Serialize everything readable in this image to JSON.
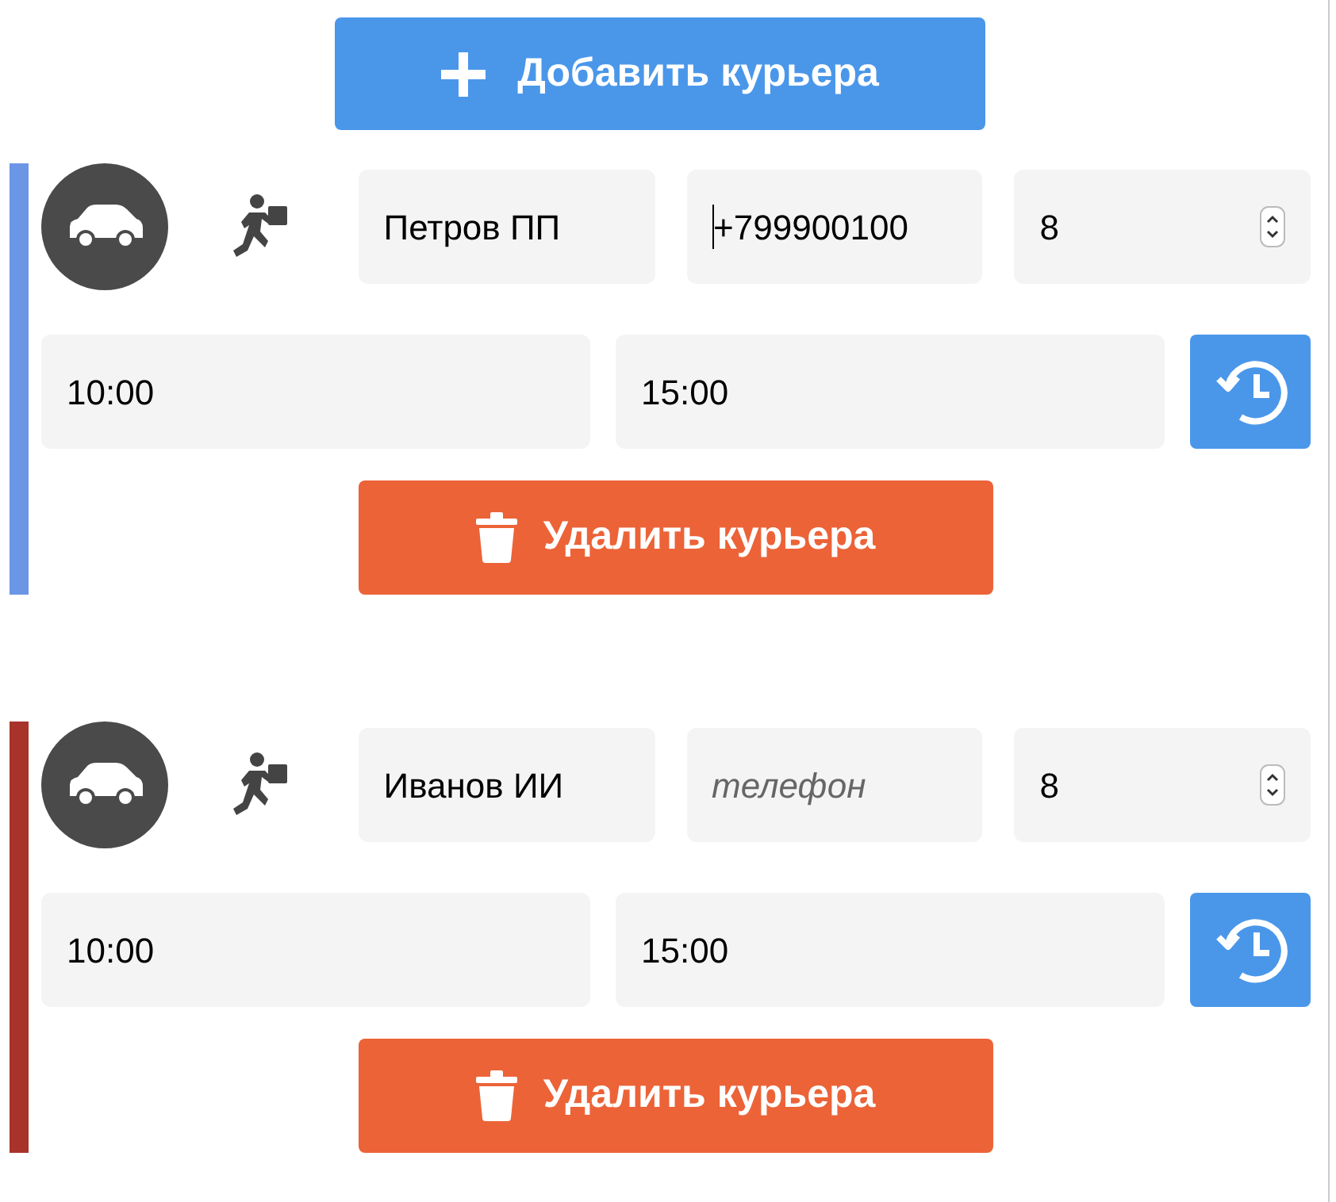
{
  "add_button": {
    "label": "Добавить курьера"
  },
  "couriers": [
    {
      "color": "#6b96e6",
      "name": {
        "value": "Петров ПП"
      },
      "phone": {
        "value": "+799900100",
        "focused": true
      },
      "count": {
        "value": "8"
      },
      "time_from": {
        "value": "10:00"
      },
      "time_to": {
        "value": "15:00"
      },
      "delete_button": {
        "label": "Удалить курьера"
      }
    },
    {
      "color": "#a8332a",
      "name": {
        "value": "Иванов ИИ"
      },
      "phone": {
        "placeholder": "телефон",
        "focused": false
      },
      "count": {
        "value": "8"
      },
      "time_from": {
        "value": "10:00"
      },
      "time_to": {
        "value": "15:00"
      },
      "delete_button": {
        "label": "Удалить курьера"
      }
    }
  ]
}
